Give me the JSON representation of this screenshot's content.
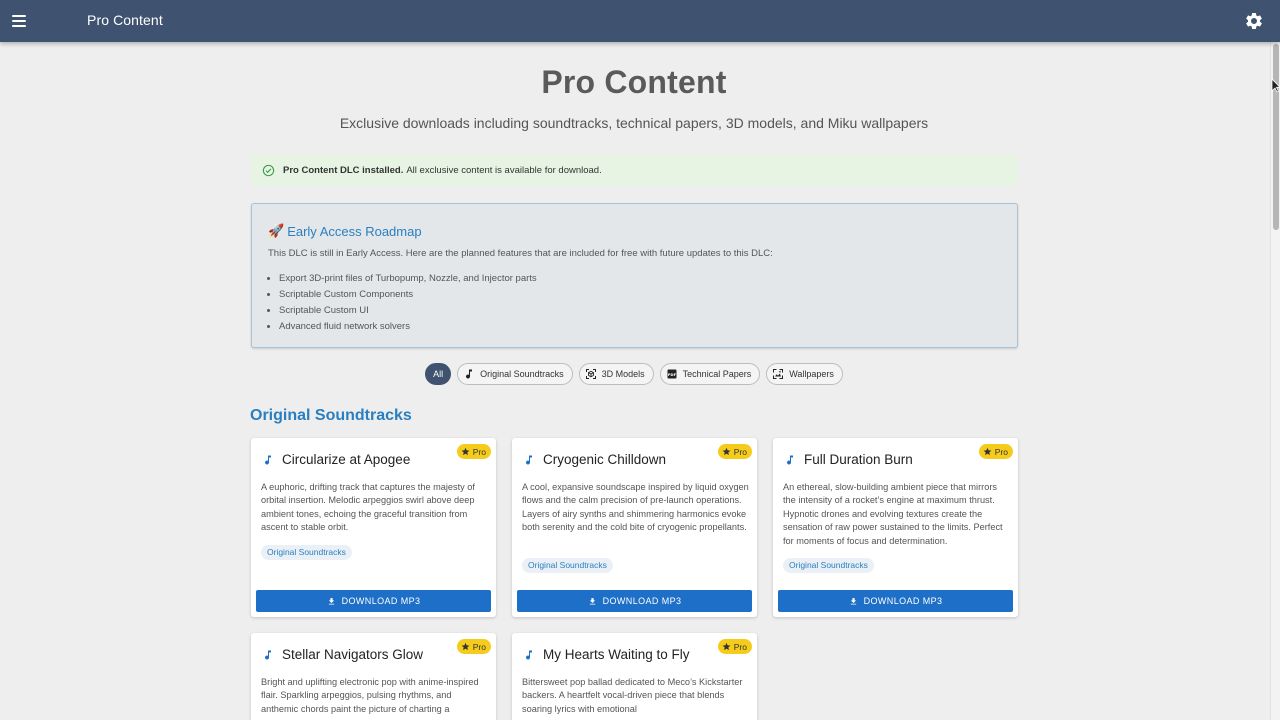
{
  "app": {
    "title": "Pro Content"
  },
  "page": {
    "title": "Pro Content",
    "subtitle": "Exclusive downloads including soundtracks, technical papers, 3D models, and Miku wallpapers"
  },
  "alert": {
    "bold": "Pro Content DLC installed.",
    "text": "All exclusive content is available for download."
  },
  "roadmap": {
    "emoji": "🚀",
    "title": "Early Access Roadmap",
    "description": "This DLC is still in Early Access. Here are the planned features that are included for free with future updates to this DLC:",
    "items": [
      "Export 3D-print files of Turbopump, Nozzle, and Injector parts",
      "Scriptable Custom Components",
      "Scriptable Custom UI",
      "Advanced fluid network solvers"
    ]
  },
  "filters": {
    "all": "All",
    "soundtracks": "Original Soundtracks",
    "models": "3D Models",
    "papers": "Technical Papers",
    "wallpapers": "Wallpapers"
  },
  "section": {
    "title": "Original Soundtracks"
  },
  "badge": {
    "label": "Pro"
  },
  "download_label": "DOWNLOAD MP3",
  "cards": [
    {
      "title": "Circularize at Apogee",
      "description": "A euphoric, drifting track that captures the majesty of orbital insertion. Melodic arpeggios swirl above deep ambient tones, echoing the graceful transition from ascent to stable orbit.",
      "tag": "Original Soundtracks"
    },
    {
      "title": "Cryogenic Chilldown",
      "description": "A cool, expansive soundscape inspired by liquid oxygen flows and the calm precision of pre-launch operations. Layers of airy synths and shimmering harmonics evoke both serenity and the cold bite of cryogenic propellants.",
      "tag": "Original Soundtracks"
    },
    {
      "title": "Full Duration Burn",
      "description": "An ethereal, slow-building ambient piece that mirrors the intensity of a rocket’s engine at maximum thrust. Hypnotic drones and evolving textures create the sensation of raw power sustained to the limits. Perfect for moments of focus and determination.",
      "tag": "Original Soundtracks"
    },
    {
      "title": "Stellar Navigators Glow",
      "description": "Bright and uplifting electronic pop with anime-inspired flair. Sparkling arpeggios, pulsing rhythms, and anthemic chords paint the picture of charting a"
    },
    {
      "title": "My Hearts Waiting to Fly",
      "description": "Bittersweet pop ballad dedicated to Meco’s Kickstarter backers. A heartfelt vocal-driven piece that blends soaring lyrics with emotional"
    }
  ]
}
